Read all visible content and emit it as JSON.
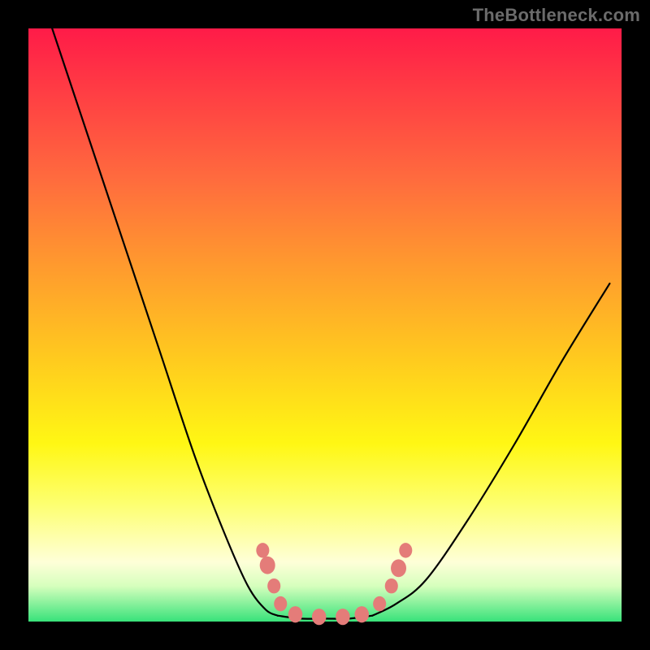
{
  "watermark": "TheBottleneck.com",
  "chart_data": {
    "type": "line",
    "title": "",
    "xlabel": "",
    "ylabel": "",
    "xlim": [
      0,
      1
    ],
    "ylim": [
      0,
      1
    ],
    "grid": false,
    "legend": false,
    "annotations": [],
    "series": [
      {
        "name": "left-curve",
        "x": [
          0.04,
          0.1,
          0.16,
          0.22,
          0.28,
          0.33,
          0.37,
          0.4,
          0.42
        ],
        "y": [
          1.0,
          0.82,
          0.64,
          0.46,
          0.28,
          0.15,
          0.06,
          0.02,
          0.01
        ]
      },
      {
        "name": "valley-floor",
        "x": [
          0.42,
          0.46,
          0.5,
          0.54,
          0.58
        ],
        "y": [
          0.01,
          0.005,
          0.005,
          0.005,
          0.01
        ]
      },
      {
        "name": "right-curve",
        "x": [
          0.58,
          0.62,
          0.67,
          0.74,
          0.82,
          0.9,
          0.98
        ],
        "y": [
          0.01,
          0.03,
          0.07,
          0.17,
          0.3,
          0.44,
          0.57
        ]
      }
    ],
    "beads": [
      {
        "x": 0.403,
        "y": 0.095,
        "r": 0.013
      },
      {
        "x": 0.395,
        "y": 0.12,
        "r": 0.011
      },
      {
        "x": 0.414,
        "y": 0.06,
        "r": 0.011
      },
      {
        "x": 0.425,
        "y": 0.03,
        "r": 0.011
      },
      {
        "x": 0.45,
        "y": 0.012,
        "r": 0.012
      },
      {
        "x": 0.49,
        "y": 0.008,
        "r": 0.012
      },
      {
        "x": 0.53,
        "y": 0.008,
        "r": 0.012
      },
      {
        "x": 0.562,
        "y": 0.012,
        "r": 0.012
      },
      {
        "x": 0.592,
        "y": 0.03,
        "r": 0.011
      },
      {
        "x": 0.612,
        "y": 0.06,
        "r": 0.011
      },
      {
        "x": 0.624,
        "y": 0.09,
        "r": 0.013
      },
      {
        "x": 0.636,
        "y": 0.12,
        "r": 0.011
      }
    ],
    "gradient_stops": [
      {
        "pos": 0.0,
        "color": "#ff1b48"
      },
      {
        "pos": 0.1,
        "color": "#ff3b44"
      },
      {
        "pos": 0.25,
        "color": "#ff6a3e"
      },
      {
        "pos": 0.4,
        "color": "#ff9a2e"
      },
      {
        "pos": 0.55,
        "color": "#ffc81f"
      },
      {
        "pos": 0.7,
        "color": "#fff714"
      },
      {
        "pos": 0.8,
        "color": "#fdff6e"
      },
      {
        "pos": 0.9,
        "color": "#feffd8"
      },
      {
        "pos": 0.94,
        "color": "#d6ffbd"
      },
      {
        "pos": 1.0,
        "color": "#38e27a"
      }
    ]
  }
}
